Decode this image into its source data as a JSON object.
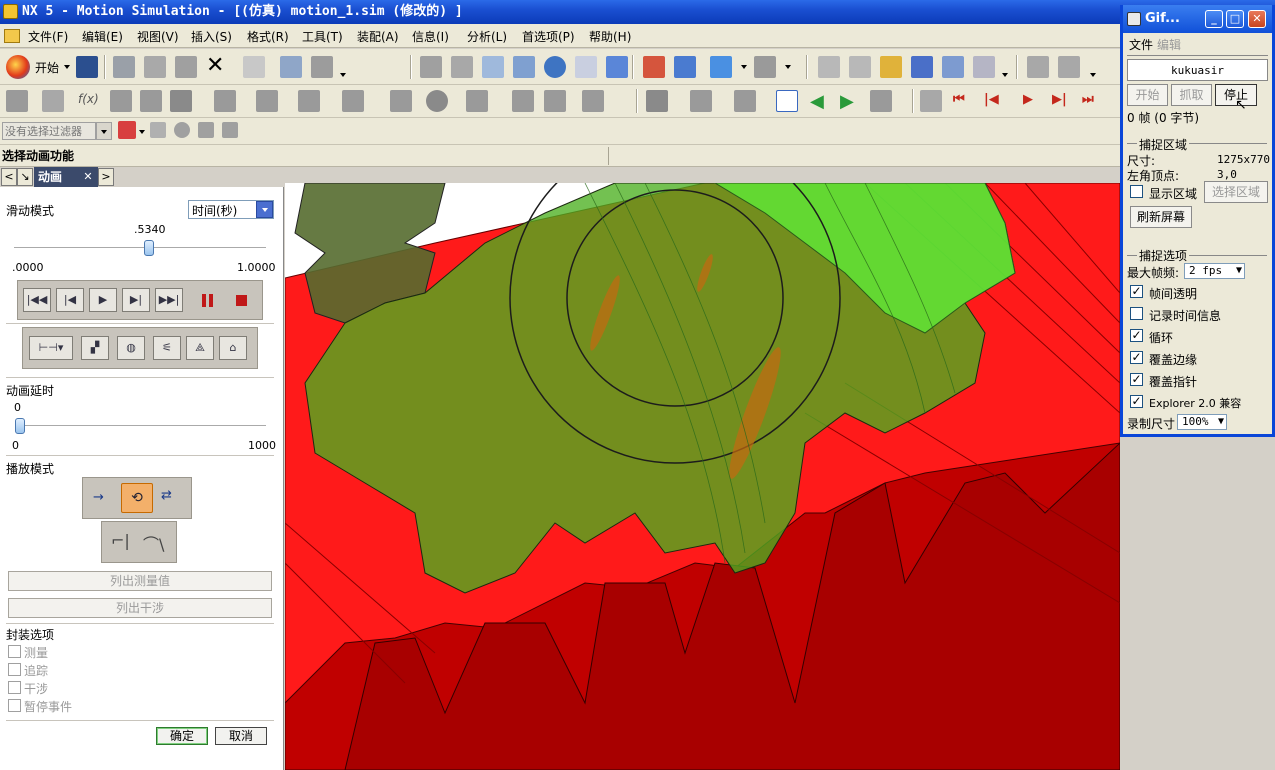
{
  "app": {
    "title": "NX 5 - Motion Simulation - [(仿真) motion_1.sim  (修改的) ]"
  },
  "menu": [
    "文件(F)",
    "编辑(E)",
    "视图(V)",
    "插入(S)",
    "格式(R)",
    "工具(T)",
    "装配(A)",
    "信息(I)",
    "分析(L)",
    "首选项(P)",
    "帮助(H)"
  ],
  "toolbar": {
    "start_label": "开始",
    "filter_placeholder": "没有选择过滤器"
  },
  "status": {
    "prompt": "选择动画功能"
  },
  "panel": {
    "tab_label": "动画",
    "slide_mode_label": "滑动模式",
    "slide_mode_value": "时间(秒)",
    "slider_value": ".5340",
    "slider_min": ".0000",
    "slider_max": "1.0000",
    "slider_fraction": 0.534,
    "delay_label": "动画延时",
    "delay_value": "0",
    "delay_min": "0",
    "delay_max": "1000",
    "playback_label": "播放模式",
    "list_measure": "列出测量值",
    "list_interference": "列出干涉",
    "envelope_label": "封装选项",
    "envelope_options": [
      "测量",
      "追踪",
      "干涉",
      "暂停事件"
    ],
    "ok": "确定",
    "cancel": "取消"
  },
  "gif": {
    "title": "Gif...",
    "menu_file": "文件",
    "menu_edit": "编辑",
    "name": "kukuasir",
    "btn_start": "开始",
    "btn_capture": "抓取",
    "btn_stop": "停止",
    "frames": "0 帧 (0 字节)",
    "capture_area_label": "捕捉区域",
    "size_label": "尺寸:",
    "size_value": "1275x770",
    "corner_label": "左角顶点:",
    "corner_value": "3,0",
    "show_area": "显示区域",
    "select_area": "选择区域",
    "refresh": "刷新屏幕",
    "capture_options_label": "捕捉选项",
    "max_fps_label": "最大帧频:",
    "max_fps_value": "2 fps",
    "options": [
      {
        "label": "帧间透明",
        "checked": true
      },
      {
        "label": "记录时间信息",
        "checked": false
      },
      {
        "label": "循环",
        "checked": true
      },
      {
        "label": "覆盖边缘",
        "checked": true
      },
      {
        "label": "覆盖指针",
        "checked": true
      },
      {
        "label": "Explorer 2.0 兼容",
        "checked": true
      }
    ],
    "record_size_label": "录制尺寸",
    "record_size_value": "100%"
  }
}
